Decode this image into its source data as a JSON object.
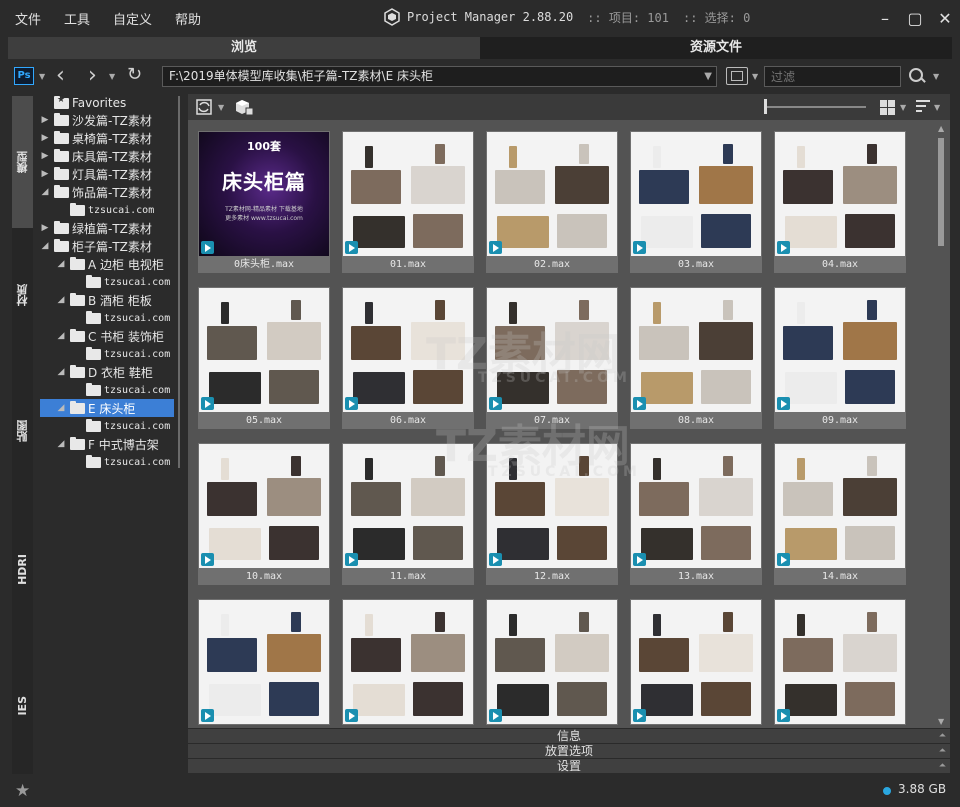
{
  "menu": [
    "文件",
    "工具",
    "自定义",
    "帮助"
  ],
  "app": {
    "title": "Project Manager 2.88.20",
    "items_label": ":: 项目: 101",
    "selection_label": ":: 选择: 0"
  },
  "tabs": [
    {
      "label": "浏览",
      "active": true
    },
    {
      "label": "资源文件",
      "active": false
    }
  ],
  "toolbar": {
    "path": "F:\\2019单体模型库收集\\柜子篇-TZ素材\\E 床头柜",
    "filter_placeholder": "过滤"
  },
  "side_tabs": [
    "模型",
    "材质",
    "贴图",
    "HDRI",
    "IES"
  ],
  "tree": [
    {
      "label": "Favorites",
      "level": 0,
      "star": true
    },
    {
      "label": "沙发篇-TZ素材",
      "level": 0,
      "expandable": true
    },
    {
      "label": "桌椅篇-TZ素材",
      "level": 0,
      "expandable": true
    },
    {
      "label": "床具篇-TZ素材",
      "level": 0,
      "expandable": true
    },
    {
      "label": "灯具篇-TZ素材",
      "level": 0,
      "expandable": true
    },
    {
      "label": "饰品篇-TZ素材",
      "level": 0,
      "expandable": true
    },
    {
      "label": "tzsucai.com",
      "level": 1,
      "small": true
    },
    {
      "label": "绿植篇-TZ素材",
      "level": 0,
      "expandable": true
    },
    {
      "label": "柜子篇-TZ素材",
      "level": 0,
      "expandable": true,
      "expanded": true
    },
    {
      "label": "A 边柜 电视柜",
      "level": 1,
      "expandable": true,
      "expanded": true
    },
    {
      "label": "tzsucai.com",
      "level": 2,
      "small": true
    },
    {
      "label": "B 酒柜 柜板",
      "level": 1,
      "expandable": true,
      "expanded": true
    },
    {
      "label": "tzsucai.com",
      "level": 2,
      "small": true
    },
    {
      "label": "C 书柜 装饰柜",
      "level": 1,
      "expandable": true,
      "expanded": true
    },
    {
      "label": "tzsucai.com",
      "level": 2,
      "small": true
    },
    {
      "label": "D 衣柜 鞋柜",
      "level": 1,
      "expandable": true,
      "expanded": true
    },
    {
      "label": "tzsucai.com",
      "level": 2,
      "small": true
    },
    {
      "label": "E 床头柜",
      "level": 1,
      "expandable": true,
      "expanded": true,
      "selected": true
    },
    {
      "label": "tzsucai.com",
      "level": 2,
      "small": true
    },
    {
      "label": "F 中式博古架",
      "level": 1,
      "expandable": true,
      "expanded": true
    },
    {
      "label": "tzsucai.com",
      "level": 2,
      "small": true
    }
  ],
  "cover": {
    "line1": "100套",
    "line2": "床头柜篇",
    "line3": "TZ素材网-精品素材 下载基地",
    "line4": "更多素材 www.tzsucai.com"
  },
  "thumbnails": [
    "0床头柜.max",
    "01.max",
    "02.max",
    "03.max",
    "04.max",
    "05.max",
    "06.max",
    "07.max",
    "08.max",
    "09.max",
    "10.max",
    "11.max",
    "12.max",
    "13.max",
    "14.max",
    "",
    "",
    "",
    "",
    ""
  ],
  "watermark": {
    "brand": "TZ素材网",
    "site": "TZSUCAI.COM"
  },
  "panels": [
    "信息",
    "放置选项",
    "设置"
  ],
  "status": {
    "size": "3.88 GB"
  }
}
